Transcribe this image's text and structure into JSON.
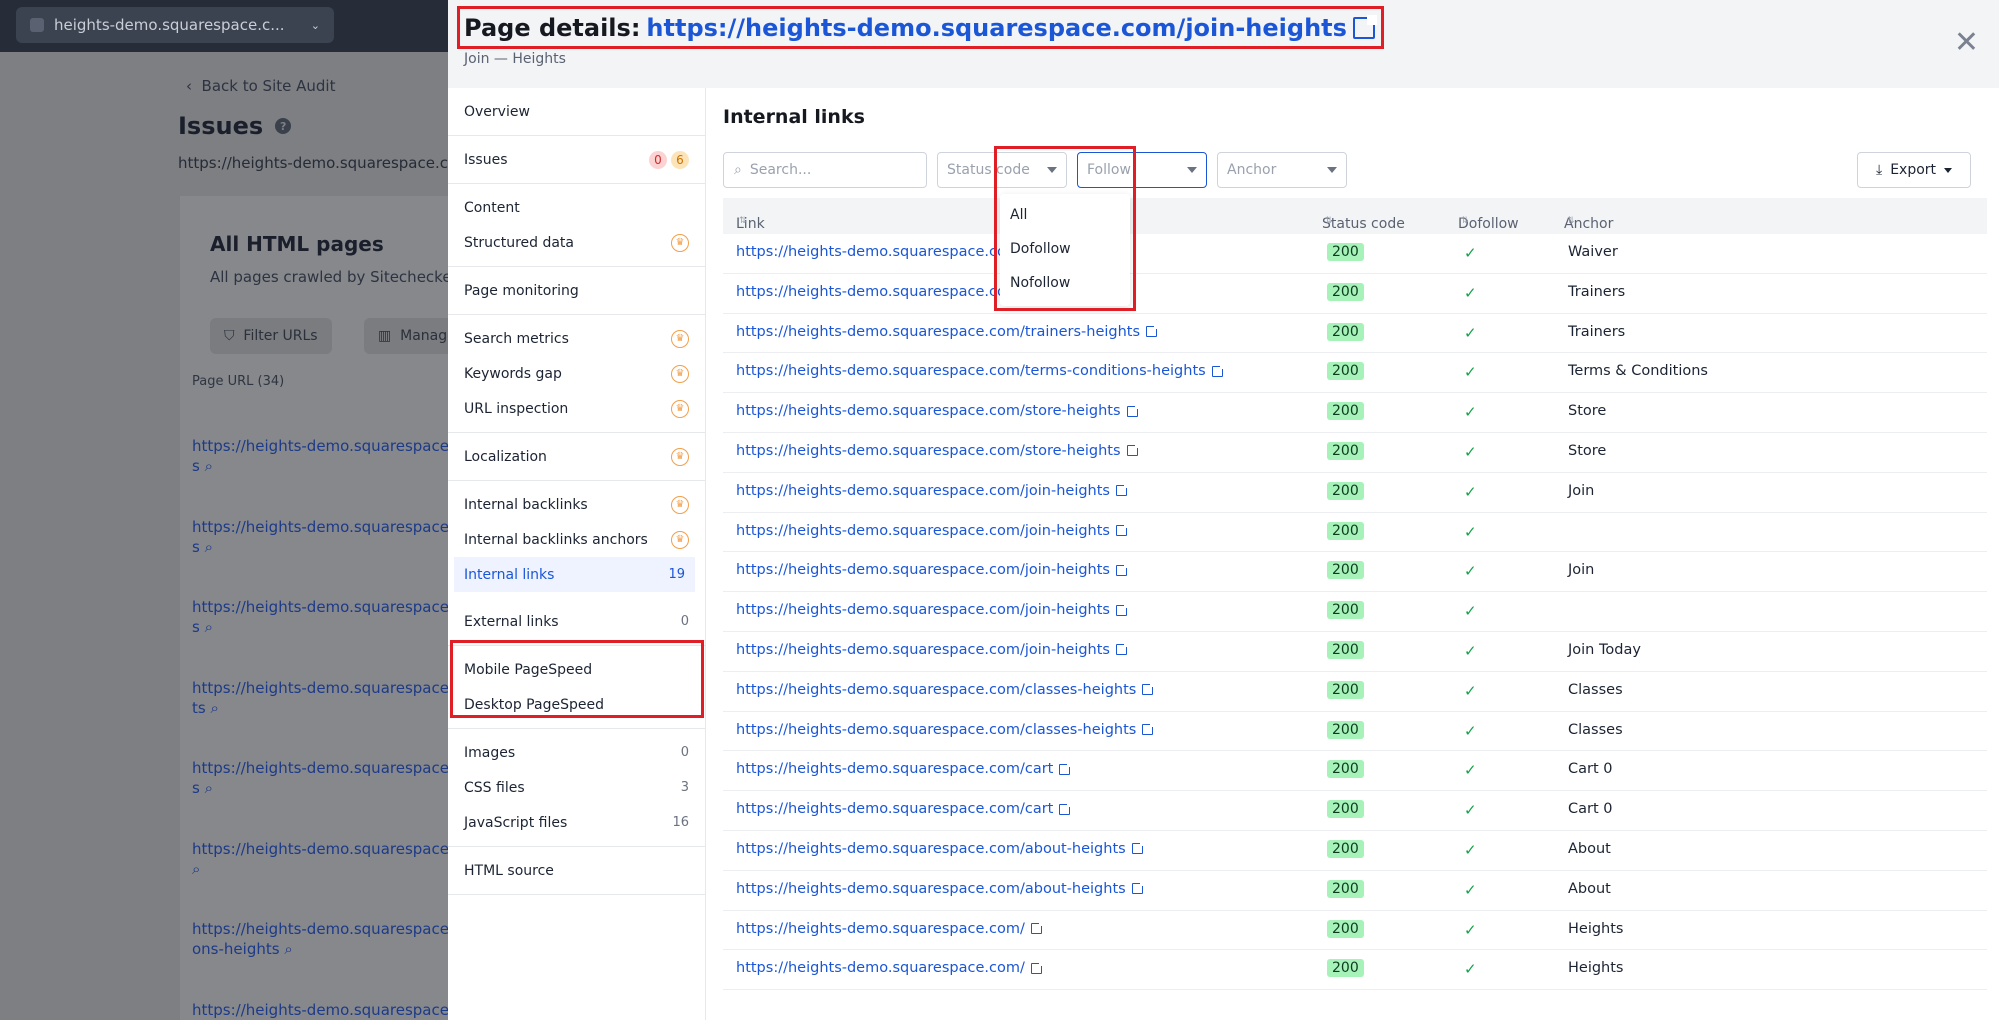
{
  "background": {
    "tab_label": "heights-demo.squarespace.c...",
    "back_label": "Back to Site Audit",
    "issues_title": "Issues",
    "site_url": "https://heights-demo.squarespace.com",
    "card_title": "All HTML pages",
    "card_subtitle": "All pages crawled by Sitechecke",
    "filter_btn": "Filter URLs",
    "manage_btn": "Manage",
    "page_url_header": "Page URL (34)",
    "rows": [
      {
        "l1": "https://heights-demo.squarespace.co",
        "l2": "s"
      },
      {
        "l1": "https://heights-demo.squarespace.co",
        "l2": "s"
      },
      {
        "l1": "https://heights-demo.squarespace.co",
        "l2": "s"
      },
      {
        "l1": "https://heights-demo.squarespace.co",
        "l2": "ts"
      },
      {
        "l1": "https://heights-demo.squarespace.co",
        "l2": "s"
      },
      {
        "l1": "https://heights-demo.squarespace.co",
        "l2": ""
      },
      {
        "l1": "https://heights-demo.squarespace.co",
        "l2": "ons-heights"
      },
      {
        "l1": "https://heights-demo.squarespace.co",
        "l2": "s"
      }
    ]
  },
  "modal": {
    "title_label": "Page details:",
    "title_url": "https://heights-demo.squarespace.com/join-heights",
    "subtitle": "Join — Heights",
    "close_symbol": "✕"
  },
  "sidebar": {
    "overview": "Overview",
    "issues": {
      "label": "Issues",
      "errors": "0",
      "warnings": "6"
    },
    "content": "Content",
    "structured_data": "Structured data",
    "page_monitoring": "Page monitoring",
    "search_metrics": "Search metrics",
    "keywords_gap": "Keywords gap",
    "url_inspection": "URL inspection",
    "localization": "Localization",
    "internal_backlinks": "Internal backlinks",
    "internal_backlinks_anchors": "Internal backlinks anchors",
    "internal_links": {
      "label": "Internal links",
      "count": "19"
    },
    "external_links": {
      "label": "External links",
      "count": "0"
    },
    "mobile_pagespeed": "Mobile PageSpeed",
    "desktop_pagespeed": "Desktop PageSpeed",
    "images": {
      "label": "Images",
      "count": "0"
    },
    "css_files": {
      "label": "CSS files",
      "count": "3"
    },
    "js_files": {
      "label": "JavaScript files",
      "count": "16"
    },
    "html_source": "HTML source"
  },
  "main": {
    "heading": "Internal links",
    "search_placeholder": "Search...",
    "status_code_filter": "Status code",
    "follow_filter": "Follow",
    "anchor_filter": "Anchor",
    "follow_options": [
      "All",
      "Dofollow",
      "Nofollow"
    ],
    "export_label": "Export",
    "columns": {
      "link": "Link",
      "status_code": "Status code",
      "dofollow": "Dofollow",
      "anchor": "Anchor"
    },
    "rows": [
      {
        "link": "https://heights-demo.squarespace.com/waiver-h",
        "status": "200",
        "anchor": "Waiver"
      },
      {
        "link": "https://heights-demo.squarespace.com/trainers-",
        "status": "200",
        "anchor": "Trainers"
      },
      {
        "link": "https://heights-demo.squarespace.com/trainers-heights",
        "status": "200",
        "anchor": "Trainers"
      },
      {
        "link": "https://heights-demo.squarespace.com/terms-conditions-heights",
        "status": "200",
        "anchor": "Terms & Conditions"
      },
      {
        "link": "https://heights-demo.squarespace.com/store-heights",
        "status": "200",
        "anchor": "Store"
      },
      {
        "link": "https://heights-demo.squarespace.com/store-heights",
        "status": "200",
        "anchor": "Store"
      },
      {
        "link": "https://heights-demo.squarespace.com/join-heights",
        "status": "200",
        "anchor": "Join"
      },
      {
        "link": "https://heights-demo.squarespace.com/join-heights",
        "status": "200",
        "anchor": ""
      },
      {
        "link": "https://heights-demo.squarespace.com/join-heights",
        "status": "200",
        "anchor": "Join"
      },
      {
        "link": "https://heights-demo.squarespace.com/join-heights",
        "status": "200",
        "anchor": ""
      },
      {
        "link": "https://heights-demo.squarespace.com/join-heights",
        "status": "200",
        "anchor": "Join Today"
      },
      {
        "link": "https://heights-demo.squarespace.com/classes-heights",
        "status": "200",
        "anchor": "Classes"
      },
      {
        "link": "https://heights-demo.squarespace.com/classes-heights",
        "status": "200",
        "anchor": "Classes"
      },
      {
        "link": "https://heights-demo.squarespace.com/cart",
        "status": "200",
        "anchor": "Cart 0"
      },
      {
        "link": "https://heights-demo.squarespace.com/cart",
        "status": "200",
        "anchor": "Cart 0"
      },
      {
        "link": "https://heights-demo.squarespace.com/about-heights",
        "status": "200",
        "anchor": "About"
      },
      {
        "link": "https://heights-demo.squarespace.com/about-heights",
        "status": "200",
        "anchor": "About"
      },
      {
        "link": "https://heights-demo.squarespace.com/",
        "status": "200",
        "anchor": "Heights"
      },
      {
        "link": "https://heights-demo.squarespace.com/",
        "status": "200",
        "anchor": "Heights"
      }
    ]
  },
  "colors": {
    "accent": "#1a56d6",
    "highlight": "#e01e26",
    "status_ok": "#a6f2b9",
    "check": "#16a34a"
  }
}
